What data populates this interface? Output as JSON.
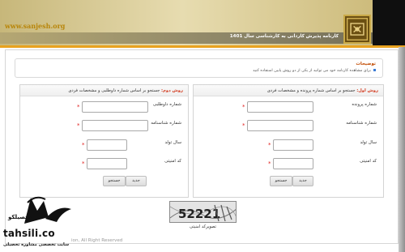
{
  "header": {
    "site_url": "www.sanjesh.org",
    "title": "کارنامه پذیرش کاردانی به کارشناسی سال 1401",
    "accent_color": "#e8a21f"
  },
  "description": {
    "title": "توضیحات",
    "text": "برای مشاهده کارنامه خود می توانید از یکی از دو روش پایین استفاده کنید"
  },
  "panel_right": {
    "method": "روش اول:",
    "heading": "جستجو بر اساس شماره پرونده و مشخصات فردی",
    "fields": [
      {
        "label": "شماره پرونده",
        "value": ""
      },
      {
        "label": "شماره شناسنامه",
        "value": ""
      },
      {
        "label": "سال تولد",
        "value": ""
      },
      {
        "label": "کد امنیتی",
        "value": ""
      }
    ],
    "search_button": "جستجو",
    "new_button": "جدید"
  },
  "panel_left": {
    "method": "روش دوم:",
    "heading": "جستجو بر اساس شماره داوطلبی و مشخصات فردی",
    "fields": [
      {
        "label": "شماره داوطلبی",
        "value": ""
      },
      {
        "label": "شماره شناسنامه",
        "value": ""
      },
      {
        "label": "سال تولد",
        "value": ""
      },
      {
        "label": "کد امنیتی",
        "value": ""
      }
    ],
    "search_button": "جستجو",
    "new_button": "جدید"
  },
  "captcha": {
    "code": "52221",
    "label": "تصویرکد امنیتی"
  },
  "footer": {
    "text": "ion, All Right Reserved"
  },
  "watermark": {
    "name": "تحصیلکو",
    "domain": "tahsili.co",
    "tagline": "سایت تخصصی مشاوره تحصیلی"
  }
}
